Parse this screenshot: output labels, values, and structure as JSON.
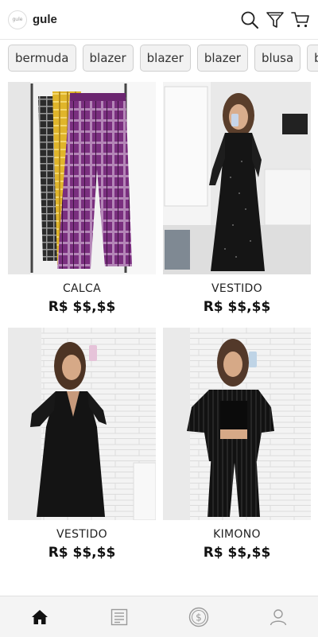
{
  "header": {
    "logo_text": "gule",
    "brand": "gule"
  },
  "chips": [
    "bermuda",
    "blazer",
    "blazer",
    "blazer",
    "blusa",
    "blusa"
  ],
  "products": [
    {
      "name": "CALCA",
      "price": "R$ $$,$$"
    },
    {
      "name": "VESTIDO",
      "price": "R$ $$,$$"
    },
    {
      "name": "VESTIDO",
      "price": "R$ $$,$$"
    },
    {
      "name": "KIMONO",
      "price": "R$ $$,$$"
    }
  ],
  "icons": {
    "header": [
      "search-icon",
      "filter-icon",
      "cart-icon"
    ],
    "bottom_nav": [
      "home-icon",
      "orders-icon",
      "money-icon",
      "user-icon"
    ]
  },
  "colors": {
    "chip_bg": "#f2f2f2",
    "nav_bg": "#f4f4f4",
    "text": "#111111"
  }
}
